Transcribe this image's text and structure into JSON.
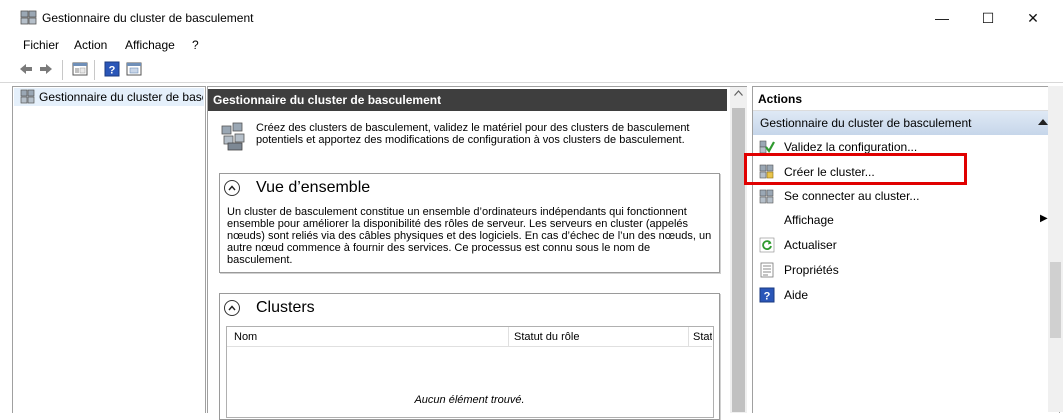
{
  "window": {
    "title": "Gestionnaire du cluster de basculement",
    "minimize_glyph": "—",
    "maximize_glyph": "☐",
    "close_glyph": "✕"
  },
  "menu": [
    "Fichier",
    "Action",
    "Affichage",
    "?"
  ],
  "toolbar": {
    "icons": [
      "back-arrow-icon",
      "forward-arrow-icon",
      "console-tree-icon",
      "help-icon",
      "show-hide-action-pane-icon"
    ]
  },
  "tree": {
    "root_label": "Gestionnaire du cluster de basc"
  },
  "center": {
    "header": "Gestionnaire du cluster de basculement",
    "intro": "Créez des clusters de basculement, validez le matériel pour des clusters de basculement potentiels et apportez des modifications de configuration à vos clusters de basculement.",
    "overview": {
      "title": "Vue d’ensemble",
      "text": "Un cluster de basculement constitue un ensemble d’ordinateurs indépendants qui fonctionnent ensemble pour améliorer la disponibilité des rôles de serveur. Les serveurs en cluster (appelés nœuds) sont reliés via des câbles physiques et des logiciels. En cas d’échec de l’un des nœuds, un autre nœud commence à fournir des services. Ce processus est connu sous le nom de basculement."
    },
    "clusters": {
      "title": "Clusters",
      "columns": [
        "Nom",
        "Statut du rôle",
        "Stat"
      ],
      "empty_text": "Aucun élément trouvé."
    }
  },
  "actions": {
    "header": "Actions",
    "group": "Gestionnaire du cluster de basculement",
    "items": [
      {
        "label": "Validez la configuration...",
        "icon": "validate-icon"
      },
      {
        "label": "Créer le cluster...",
        "icon": "create-cluster-icon"
      },
      {
        "label": "Se connecter au cluster...",
        "icon": "connect-cluster-icon"
      },
      {
        "label": "Affichage",
        "icon": "",
        "submenu_glyph": "▶"
      },
      {
        "label": "Actualiser",
        "icon": "refresh-icon"
      },
      {
        "label": "Propriétés",
        "icon": "properties-icon"
      },
      {
        "label": "Aide",
        "icon": "help-icon"
      }
    ]
  },
  "colors": {
    "highlight_box": "#e00000",
    "center_header_bg": "#3e3e3e",
    "actions_group_bg": "#cfdcec"
  }
}
